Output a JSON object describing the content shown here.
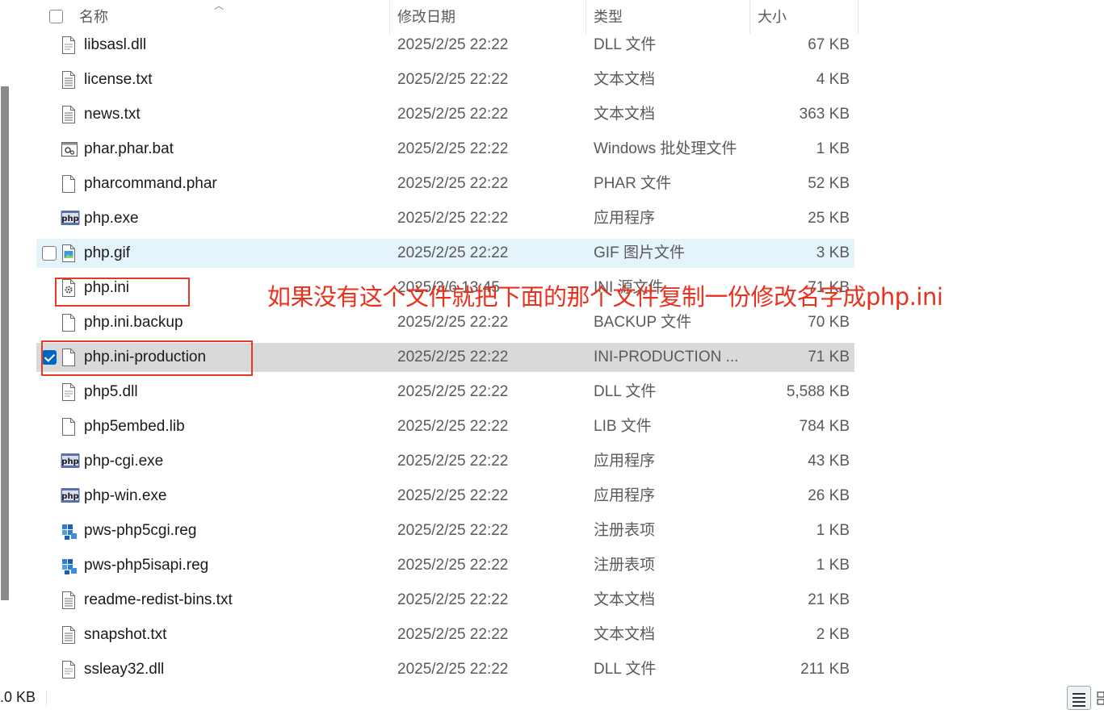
{
  "header": {
    "name": "名称",
    "date": "修改日期",
    "type": "类型",
    "size": "大小"
  },
  "files": [
    {
      "name": "libsasl.dll",
      "date": "2025/2/25 22:22",
      "type": "DLL 文件",
      "size": "67 KB",
      "icon": "dll-file-icon"
    },
    {
      "name": "license.txt",
      "date": "2025/2/25 22:22",
      "type": "文本文档",
      "size": "4 KB",
      "icon": "text-file-icon"
    },
    {
      "name": "news.txt",
      "date": "2025/2/25 22:22",
      "type": "文本文档",
      "size": "363 KB",
      "icon": "text-file-icon"
    },
    {
      "name": "phar.phar.bat",
      "date": "2025/2/25 22:22",
      "type": "Windows 批处理文件",
      "size": "1 KB",
      "icon": "batch-file-icon"
    },
    {
      "name": "pharcommand.phar",
      "date": "2025/2/25 22:22",
      "type": "PHAR 文件",
      "size": "52 KB",
      "icon": "blank-file-icon"
    },
    {
      "name": "php.exe",
      "date": "2025/2/25 22:22",
      "type": "应用程序",
      "size": "25 KB",
      "icon": "php-exe-icon"
    },
    {
      "name": "php.gif",
      "date": "2025/2/25 22:22",
      "type": "GIF 图片文件",
      "size": "3 KB",
      "icon": "image-file-icon",
      "state": "hover"
    },
    {
      "name": "php.ini",
      "date": "2025/3/6 13:45",
      "type": "INI 源文件",
      "size": "71 KB",
      "icon": "config-file-icon"
    },
    {
      "name": "php.ini.backup",
      "date": "2025/2/25 22:22",
      "type": "BACKUP 文件",
      "size": "70 KB",
      "icon": "blank-file-icon"
    },
    {
      "name": "php.ini-production",
      "date": "2025/2/25 22:22",
      "type": "INI-PRODUCTION ...",
      "size": "71 KB",
      "icon": "blank-file-icon",
      "state": "selected"
    },
    {
      "name": "php5.dll",
      "date": "2025/2/25 22:22",
      "type": "DLL 文件",
      "size": "5,588 KB",
      "icon": "dll-file-icon"
    },
    {
      "name": "php5embed.lib",
      "date": "2025/2/25 22:22",
      "type": "LIB 文件",
      "size": "784 KB",
      "icon": "blank-file-icon"
    },
    {
      "name": "php-cgi.exe",
      "date": "2025/2/25 22:22",
      "type": "应用程序",
      "size": "43 KB",
      "icon": "php-exe-icon"
    },
    {
      "name": "php-win.exe",
      "date": "2025/2/25 22:22",
      "type": "应用程序",
      "size": "26 KB",
      "icon": "php-exe-icon"
    },
    {
      "name": "pws-php5cgi.reg",
      "date": "2025/2/25 22:22",
      "type": "注册表项",
      "size": "1 KB",
      "icon": "registry-file-icon"
    },
    {
      "name": "pws-php5isapi.reg",
      "date": "2025/2/25 22:22",
      "type": "注册表项",
      "size": "1 KB",
      "icon": "registry-file-icon"
    },
    {
      "name": "readme-redist-bins.txt",
      "date": "2025/2/25 22:22",
      "type": "文本文档",
      "size": "21 KB",
      "icon": "text-file-icon"
    },
    {
      "name": "snapshot.txt",
      "date": "2025/2/25 22:22",
      "type": "文本文档",
      "size": "2 KB",
      "icon": "text-file-icon"
    },
    {
      "name": "ssleay32.dll",
      "date": "2025/2/25 22:22",
      "type": "DLL 文件",
      "size": "211 KB",
      "icon": "dll-file-icon"
    }
  ],
  "annotation": "如果没有这个文件就把下面的那个文件复制一份修改名字成php.ini",
  "status": {
    "selection_size": ".0 KB"
  },
  "colors": {
    "accent": "#0067c0",
    "annotation_red": "#e8321e",
    "hover_row": "#e5f3fb",
    "selected_row": "#d9d9d9"
  }
}
